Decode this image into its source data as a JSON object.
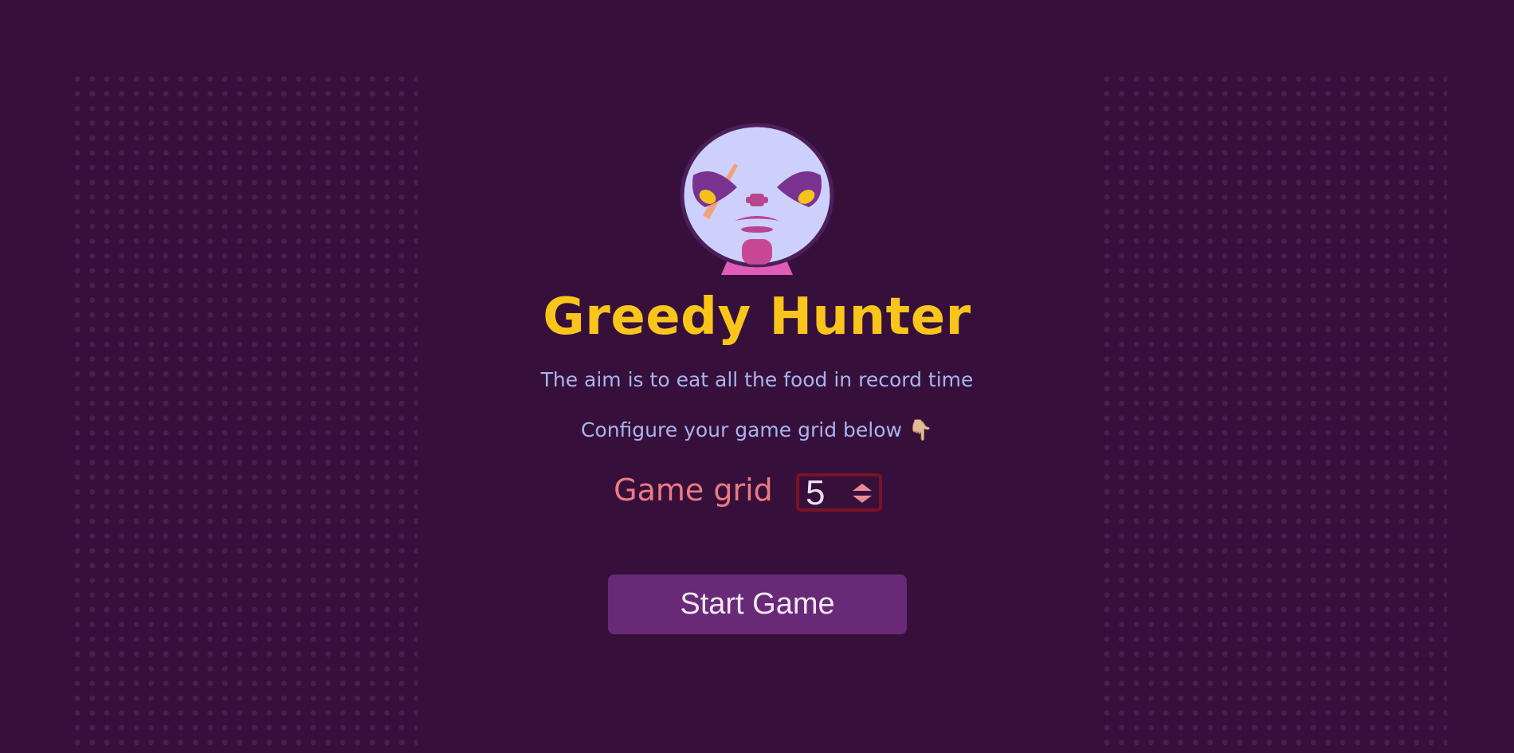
{
  "game": {
    "title": "Greedy Hunter",
    "tagline": "The aim is to eat all the food in record time",
    "configure_hint": "Configure your game grid below 👇🏼",
    "grid_label": "Game grid",
    "grid_value": "5",
    "start_label": "Start Game"
  },
  "colors": {
    "background": "#36103b",
    "title": "#f9c51a",
    "subtitle": "#aab3ee",
    "label": "#ed7a82",
    "input_border": "#7a1323",
    "button": "#682a76"
  },
  "icons": {
    "mascot": "hunter-face-avatar",
    "stepper": "up-down-arrows-icon"
  }
}
